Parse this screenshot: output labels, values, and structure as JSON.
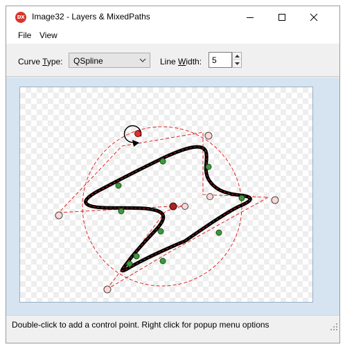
{
  "window": {
    "title": "Image32 - Layers & MixedPaths",
    "icon_text": "DX"
  },
  "menu": {
    "file": "File",
    "view": "View"
  },
  "toolbar": {
    "curve_label_pre": "Curve ",
    "curve_label_u": "T",
    "curve_label_post": "ype:",
    "curve_type_value": "QSpline",
    "width_label_pre": "Line ",
    "width_label_u": "W",
    "width_label_post": "idth:",
    "line_width_value": "5"
  },
  "status": {
    "text": "Double-click to add a control point. Right click for popup menu options"
  },
  "colors": {
    "curve": "#000000",
    "guide": "#dd2222",
    "on_curve_point": "#2e8b2e",
    "control_point": "#ffd0d0",
    "rotate_handle": "#e03030",
    "canvas_background": "#d6e4f2"
  }
}
